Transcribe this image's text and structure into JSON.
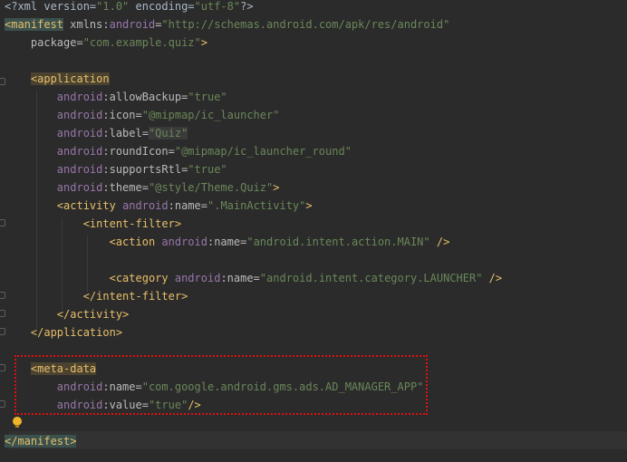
{
  "editor": {
    "lines": [
      {
        "id": "xml-decl",
        "parts": [
          {
            "t": "<?xml version=",
            "c": "plain"
          },
          {
            "t": "\"1.0\"",
            "c": "val"
          },
          {
            "t": " encoding=",
            "c": "plain"
          },
          {
            "t": "\"utf-8\"",
            "c": "val"
          },
          {
            "t": "?>",
            "c": "plain"
          }
        ]
      },
      {
        "id": "manifest-open",
        "parts": [
          {
            "t": "<manifest",
            "c": "taghl"
          },
          {
            "t": " xmlns:",
            "c": "attr"
          },
          {
            "t": "android",
            "c": "ns"
          },
          {
            "t": "=",
            "c": "attr"
          },
          {
            "t": "\"http://schemas.android.com/apk/res/android\"",
            "c": "val"
          }
        ]
      },
      {
        "id": "package",
        "parts": [
          {
            "t": "    package=",
            "c": "attr"
          },
          {
            "t": "\"com.example.quiz\"",
            "c": "val"
          },
          {
            "t": ">",
            "c": "tag"
          }
        ]
      },
      {
        "id": "blank-1",
        "parts": []
      },
      {
        "id": "application-open",
        "parts": [
          {
            "t": "    ",
            "c": "plain"
          },
          {
            "t": "<application",
            "c": "taghl2"
          }
        ]
      },
      {
        "id": "allow-backup",
        "parts": [
          {
            "t": "        ",
            "c": "plain"
          },
          {
            "t": "android",
            "c": "ns"
          },
          {
            "t": ":allowBackup=",
            "c": "attr"
          },
          {
            "t": "\"true\"",
            "c": "val"
          }
        ]
      },
      {
        "id": "icon",
        "parts": [
          {
            "t": "        ",
            "c": "plain"
          },
          {
            "t": "android",
            "c": "ns"
          },
          {
            "t": ":icon=",
            "c": "attr"
          },
          {
            "t": "\"@mipmap/ic_launcher\"",
            "c": "val"
          }
        ]
      },
      {
        "id": "label",
        "parts": [
          {
            "t": "        ",
            "c": "plain"
          },
          {
            "t": "android",
            "c": "ns"
          },
          {
            "t": ":label=",
            "c": "attr"
          },
          {
            "t": "\"Quiz\"",
            "c": "valhl"
          }
        ]
      },
      {
        "id": "round-icon",
        "parts": [
          {
            "t": "        ",
            "c": "plain"
          },
          {
            "t": "android",
            "c": "ns"
          },
          {
            "t": ":roundIcon=",
            "c": "attr"
          },
          {
            "t": "\"@mipmap/ic_launcher_round\"",
            "c": "val"
          }
        ]
      },
      {
        "id": "supports-rtl",
        "parts": [
          {
            "t": "        ",
            "c": "plain"
          },
          {
            "t": "android",
            "c": "ns"
          },
          {
            "t": ":supportsRtl=",
            "c": "attr"
          },
          {
            "t": "\"true\"",
            "c": "val"
          }
        ]
      },
      {
        "id": "theme",
        "parts": [
          {
            "t": "        ",
            "c": "plain"
          },
          {
            "t": "android",
            "c": "ns"
          },
          {
            "t": ":theme=",
            "c": "attr"
          },
          {
            "t": "\"@style/Theme.Quiz\"",
            "c": "val"
          },
          {
            "t": ">",
            "c": "tag"
          }
        ]
      },
      {
        "id": "activity-open",
        "parts": [
          {
            "t": "        ",
            "c": "plain"
          },
          {
            "t": "<activity",
            "c": "tag"
          },
          {
            "t": " ",
            "c": "plain"
          },
          {
            "t": "android",
            "c": "ns"
          },
          {
            "t": ":name=",
            "c": "attr"
          },
          {
            "t": "\".MainActivity\"",
            "c": "val"
          },
          {
            "t": ">",
            "c": "tag"
          }
        ]
      },
      {
        "id": "intent-filter-open",
        "parts": [
          {
            "t": "            ",
            "c": "plain"
          },
          {
            "t": "<intent-filter>",
            "c": "tag"
          }
        ]
      },
      {
        "id": "action",
        "parts": [
          {
            "t": "                ",
            "c": "plain"
          },
          {
            "t": "<action",
            "c": "tag"
          },
          {
            "t": " ",
            "c": "plain"
          },
          {
            "t": "android",
            "c": "ns"
          },
          {
            "t": ":name=",
            "c": "attr"
          },
          {
            "t": "\"android.intent.action.MAIN\"",
            "c": "val"
          },
          {
            "t": " />",
            "c": "tag"
          }
        ]
      },
      {
        "id": "blank-2",
        "parts": []
      },
      {
        "id": "category",
        "parts": [
          {
            "t": "                ",
            "c": "plain"
          },
          {
            "t": "<category",
            "c": "tag"
          },
          {
            "t": " ",
            "c": "plain"
          },
          {
            "t": "android",
            "c": "ns"
          },
          {
            "t": ":name=",
            "c": "attr"
          },
          {
            "t": "\"android.intent.category.LAUNCHER\"",
            "c": "val"
          },
          {
            "t": " />",
            "c": "tag"
          }
        ]
      },
      {
        "id": "intent-filter-close",
        "parts": [
          {
            "t": "            ",
            "c": "plain"
          },
          {
            "t": "</intent-filter>",
            "c": "tag"
          }
        ]
      },
      {
        "id": "activity-close",
        "parts": [
          {
            "t": "        ",
            "c": "plain"
          },
          {
            "t": "</activity>",
            "c": "tag"
          }
        ]
      },
      {
        "id": "application-close",
        "parts": [
          {
            "t": "    ",
            "c": "plain"
          },
          {
            "t": "</application>",
            "c": "tag"
          }
        ]
      },
      {
        "id": "blank-3",
        "parts": []
      },
      {
        "id": "meta-data-open",
        "parts": [
          {
            "t": "    ",
            "c": "plain"
          },
          {
            "t": "<meta-data",
            "c": "taghl2"
          }
        ]
      },
      {
        "id": "meta-name",
        "parts": [
          {
            "t": "        ",
            "c": "plain"
          },
          {
            "t": "android",
            "c": "ns"
          },
          {
            "t": ":name=",
            "c": "attr"
          },
          {
            "t": "\"com.google.android.gms.ads.AD_MANAGER_APP\"",
            "c": "val"
          }
        ]
      },
      {
        "id": "meta-value",
        "parts": [
          {
            "t": "        ",
            "c": "plain"
          },
          {
            "t": "android",
            "c": "ns"
          },
          {
            "t": ":value=",
            "c": "attr"
          },
          {
            "t": "\"true\"",
            "c": "val"
          },
          {
            "t": "/>",
            "c": "tag"
          }
        ]
      },
      {
        "id": "blank-4",
        "parts": []
      },
      {
        "id": "manifest-close",
        "parts": [
          {
            "t": "</manifest>",
            "c": "taghl"
          }
        ]
      }
    ]
  },
  "annotation": {
    "box_color": "#e01010",
    "bulb_icon": "lightbulb-icon"
  },
  "colors": {
    "background": "#2b2b2b",
    "tag": "#e8bf6a",
    "attribute": "#bababa",
    "namespace": "#9876aa",
    "value": "#6a8759"
  }
}
